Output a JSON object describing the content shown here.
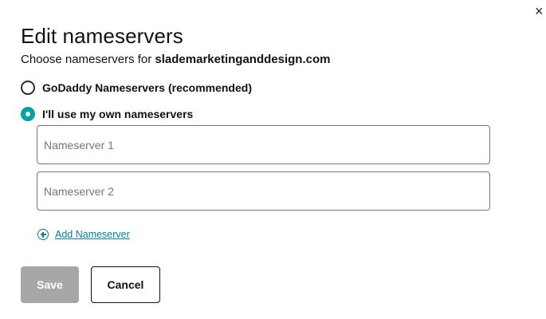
{
  "dialog": {
    "close_glyph": "×",
    "title": "Edit nameservers",
    "subtitle_prefix": "Choose nameservers for ",
    "domain": "slademarketinganddesign.com"
  },
  "options": [
    {
      "label": "GoDaddy Nameservers (recommended)",
      "checked": false
    },
    {
      "label": "I'll use my own nameservers",
      "checked": true
    }
  ],
  "nameservers": [
    {
      "placeholder": "Nameserver 1",
      "value": ""
    },
    {
      "placeholder": "Nameserver 2",
      "value": ""
    }
  ],
  "add_nameserver_label": "Add Nameserver",
  "actions": {
    "save_label": "Save",
    "cancel_label": "Cancel",
    "save_enabled": false
  },
  "colors": {
    "accent": "#00a4a6",
    "link": "#00838c",
    "disabled_button": "#a7a7a7"
  },
  "icons": {
    "close": "close-icon",
    "add": "plus-circle-icon"
  }
}
